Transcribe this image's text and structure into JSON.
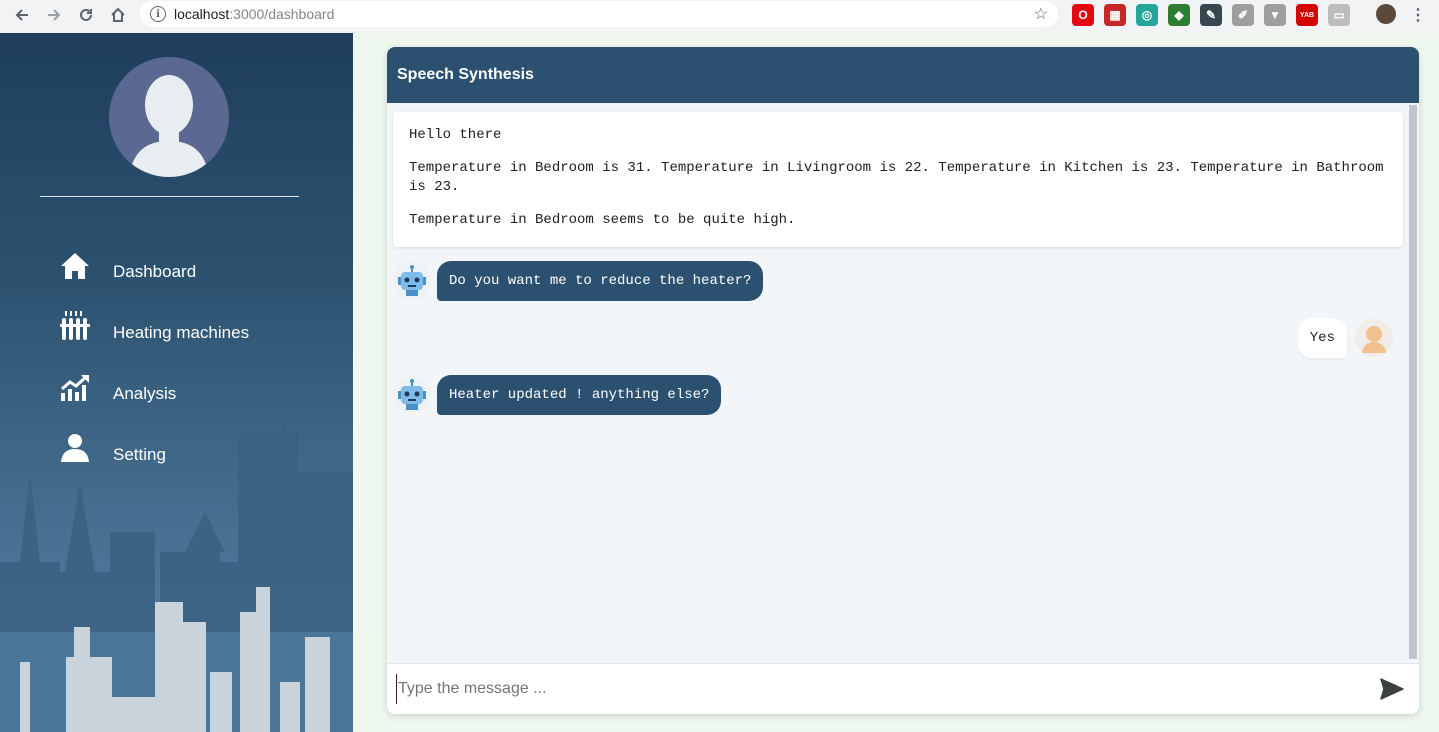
{
  "browser": {
    "url_host": "localhost",
    "url_path": ":3000/dashboard",
    "extensions": [
      {
        "name": "opera-icon",
        "color": "#e30613",
        "glyph": "O"
      },
      {
        "name": "ext-red-icon",
        "color": "#c62828",
        "glyph": "▦"
      },
      {
        "name": "ext-teal-icon",
        "color": "#26a69a",
        "glyph": "◎"
      },
      {
        "name": "ext-green-icon",
        "color": "#2e7d32",
        "glyph": "◆"
      },
      {
        "name": "ext-dark-icon",
        "color": "#37474f",
        "glyph": "✎"
      },
      {
        "name": "pencil-icon",
        "color": "#9e9e9e",
        "glyph": "✐"
      },
      {
        "name": "vue-icon",
        "color": "#9e9e9e",
        "glyph": "▼"
      },
      {
        "name": "yab-icon",
        "color": "#d50000",
        "glyph": "YAB"
      },
      {
        "name": "ext-grey-icon",
        "color": "#bdbdbd",
        "glyph": "▭"
      }
    ]
  },
  "sidebar": {
    "items": [
      {
        "label": "Dashboard",
        "icon": "home-icon"
      },
      {
        "label": "Heating machines",
        "icon": "radiator-icon"
      },
      {
        "label": "Analysis",
        "icon": "chart-up-icon"
      },
      {
        "label": "Setting",
        "icon": "user-icon"
      }
    ]
  },
  "chat": {
    "title": "Speech Synthesis",
    "info": [
      "Hello there",
      "Temperature in Bedroom is 31. Temperature in Livingroom is 22. Temperature in Kitchen is 23. Temperature in Bathroom is 23.",
      "Temperature in Bedroom seems to be quite high."
    ],
    "messages": [
      {
        "from": "bot",
        "text": "Do you want me to reduce the heater?"
      },
      {
        "from": "user",
        "text": "Yes"
      },
      {
        "from": "bot",
        "text": "Heater updated ! anything else?"
      }
    ],
    "input_placeholder": "Type the message ...",
    "input_value": ""
  },
  "colors": {
    "header": "#2b5070",
    "bot_bubble": "#2b5070",
    "sidebar_top": "#1f3f5c",
    "sidebar_bottom": "#5d87ab"
  }
}
